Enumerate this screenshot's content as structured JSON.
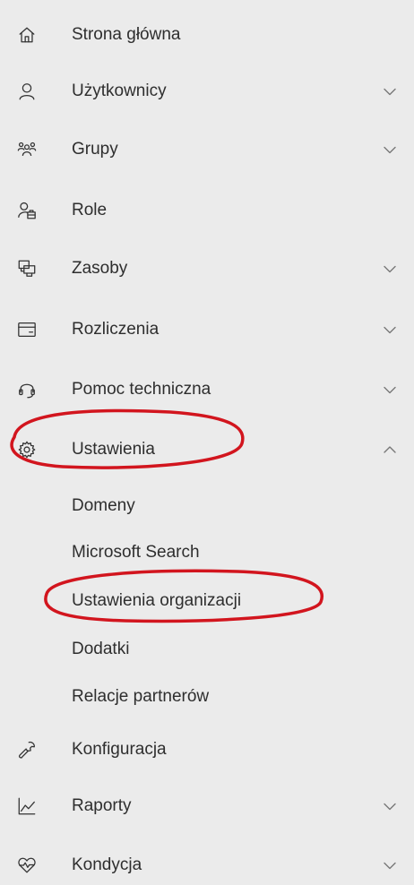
{
  "nav": {
    "items": [
      {
        "label": "Strona główna",
        "icon": "home-icon"
      },
      {
        "label": "Użytkownicy",
        "icon": "person-icon",
        "expandable": true
      },
      {
        "label": "Grupy",
        "icon": "groups-icon",
        "expandable": true
      },
      {
        "label": "Role",
        "icon": "roles-icon"
      },
      {
        "label": "Zasoby",
        "icon": "resources-icon",
        "expandable": true
      },
      {
        "label": "Rozliczenia",
        "icon": "billing-card-icon",
        "expandable": true
      },
      {
        "label": "Pomoc techniczna",
        "icon": "headset-icon",
        "expandable": true
      },
      {
        "label": "Ustawienia",
        "icon": "gear-icon",
        "expanded": true
      },
      {
        "label": "Konfiguracja",
        "icon": "wrench-icon"
      },
      {
        "label": "Raporty",
        "icon": "chart-icon",
        "expandable": true
      },
      {
        "label": "Kondycja",
        "icon": "health-heart-icon",
        "expandable": true
      }
    ],
    "settings_subitems": [
      {
        "label": "Domeny"
      },
      {
        "label": "Microsoft Search"
      },
      {
        "label": "Ustawienia organizacji"
      },
      {
        "label": "Dodatki"
      },
      {
        "label": "Relacje partnerów"
      }
    ]
  },
  "colors": {
    "background": "#ebebeb",
    "text": "#2e2e2e",
    "annotation": "#d2151e"
  }
}
